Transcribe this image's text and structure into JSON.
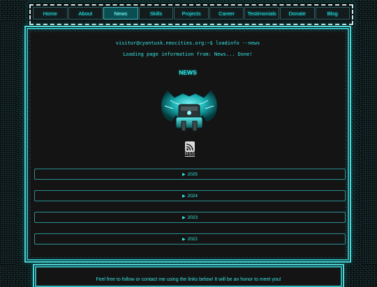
{
  "nav": {
    "items": [
      {
        "label": "Home"
      },
      {
        "label": "About"
      },
      {
        "label": "News"
      },
      {
        "label": "Skills"
      },
      {
        "label": "Projects"
      },
      {
        "label": "Career"
      },
      {
        "label": "Testimonials"
      },
      {
        "label": "Donate"
      },
      {
        "label": "Blog"
      }
    ],
    "active": "News"
  },
  "terminal": {
    "prompt": "visitor@cyantusk.neocities.org:~$ loadinfo --news",
    "status": "Loading page information from: News... Done!"
  },
  "page": {
    "title": "NEWS",
    "rss_label": "RSS",
    "rss_icon": "rss-feed-icon"
  },
  "years": [
    {
      "label": "2025",
      "marker": "▶"
    },
    {
      "label": "2024",
      "marker": "▶"
    },
    {
      "label": "2023",
      "marker": "▶"
    },
    {
      "label": "2022",
      "marker": "▶"
    }
  ],
  "footer": {
    "text": "Feel free to follow or contact me using the links below! It will be an honor to meet you!"
  },
  "colors": {
    "accent": "#37e6e6",
    "active_tab": "#0b4e52",
    "panel_bg": "#141414"
  }
}
